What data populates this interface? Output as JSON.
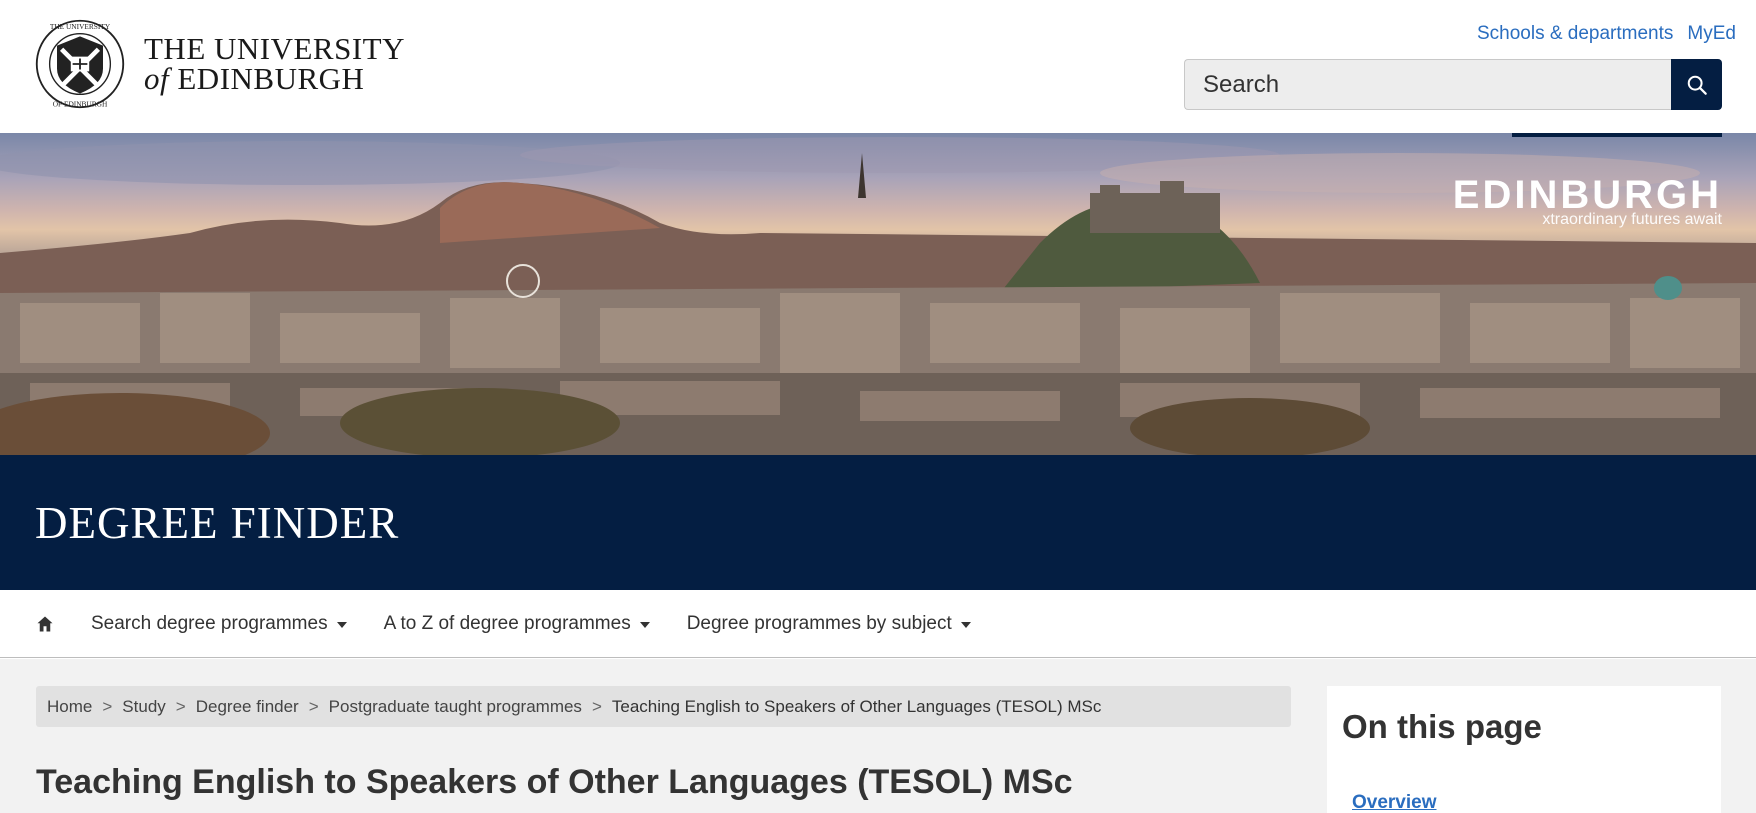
{
  "header": {
    "logo_line1": "THE UNIVERSITY",
    "logo_of": "of",
    "logo_line2": "EDINBURGH",
    "utility_links": [
      "Schools & departments",
      "MyEd"
    ],
    "search_placeholder": "Search",
    "search_icon": "search-icon"
  },
  "hero": {
    "brand_initial": "E",
    "brand_rest": "DINBURGH",
    "brand_tagline": "xtraordinary futures await"
  },
  "band": {
    "title": "DEGREE FINDER"
  },
  "nav": {
    "home_icon": "home-icon",
    "items": [
      "Search degree programmes",
      "A to Z of degree programmes",
      "Degree programmes by subject"
    ]
  },
  "breadcrumb": {
    "items": [
      "Home",
      "Study",
      "Degree finder",
      "Postgraduate taught programmes"
    ],
    "current": "Teaching English to Speakers of Other Languages (TESOL) MSc",
    "separator": ">"
  },
  "main": {
    "title": "Teaching English to Speakers of Other Languages (TESOL) MSc"
  },
  "sidebar": {
    "heading": "On this page",
    "links": [
      "Overview"
    ]
  },
  "colors": {
    "navy": "#041e42",
    "link": "#2a6dbf",
    "page_bg": "#f2f2f2",
    "breadcrumb_bg": "#e1e1e1"
  }
}
